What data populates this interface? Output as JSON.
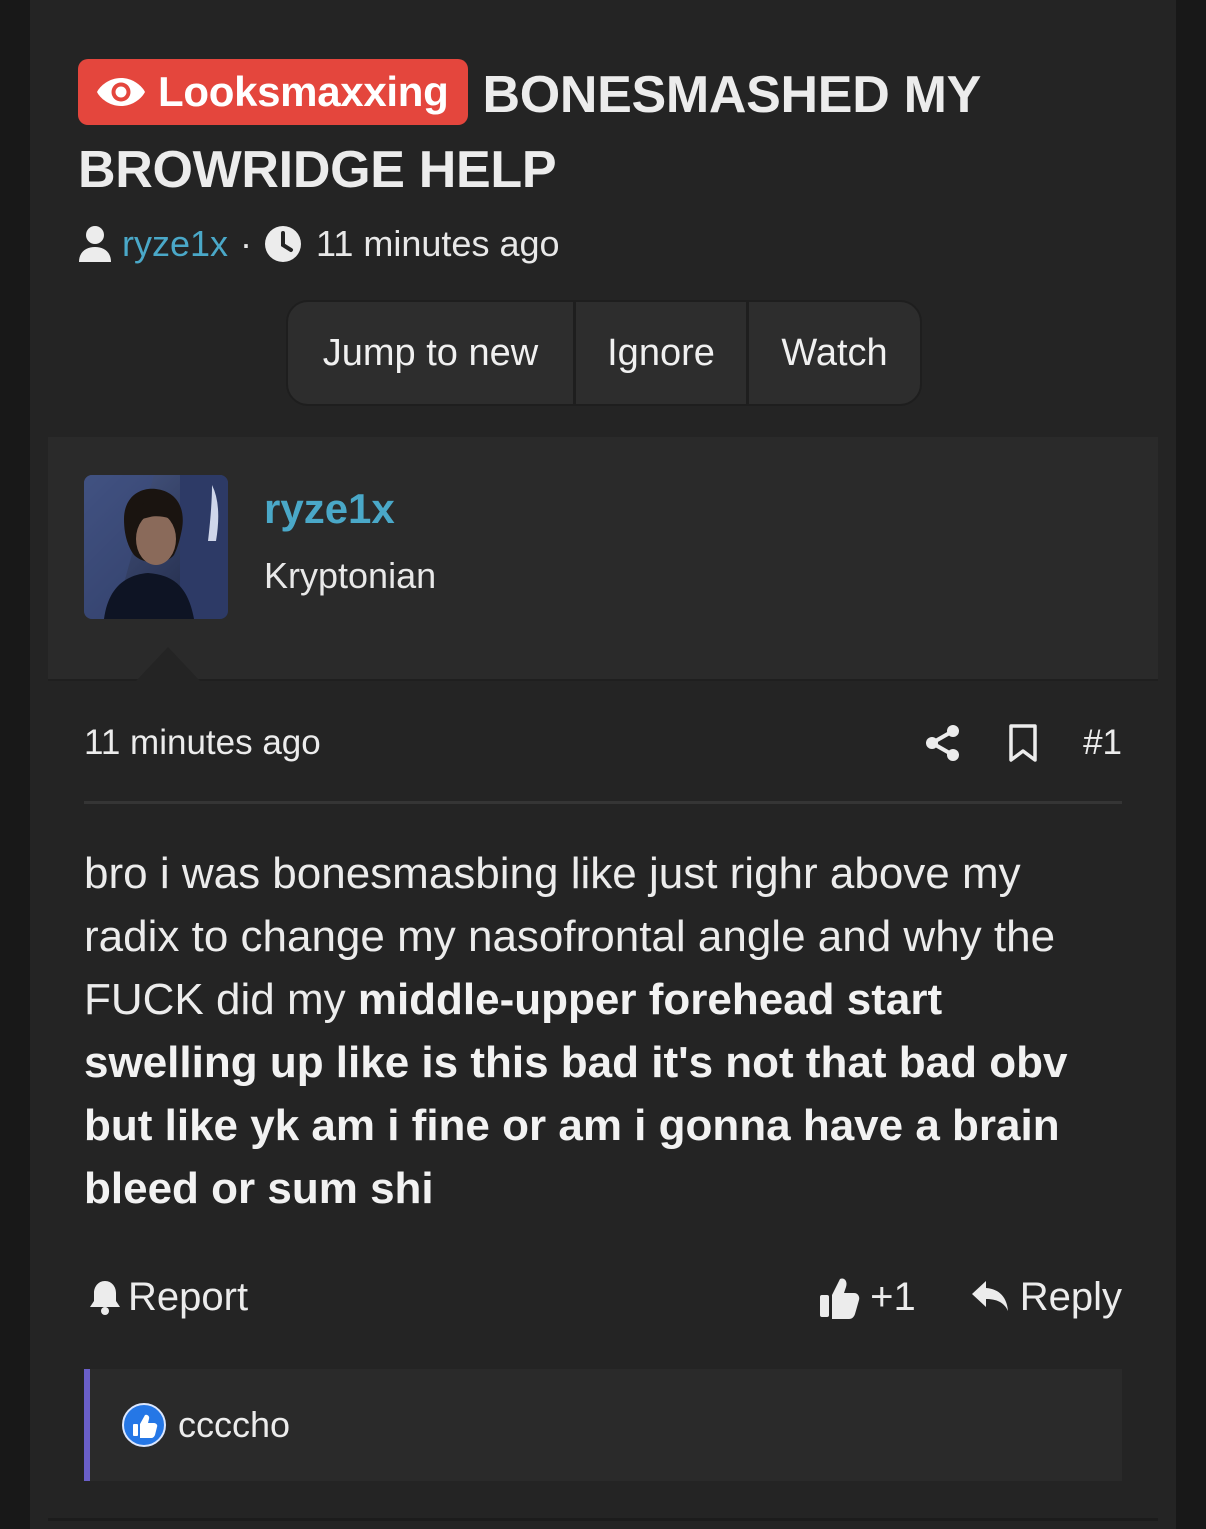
{
  "thread": {
    "prefix": "Looksmaxxing",
    "title": "BONESMASHED MY BROWRIDGE HELP",
    "author": "ryze1x",
    "separator": "·",
    "time": "11 minutes ago"
  },
  "buttons": {
    "jump": "Jump to new",
    "ignore": "Ignore",
    "watch": "Watch"
  },
  "user": {
    "name": "ryze1x",
    "title": "Kryptonian"
  },
  "post": {
    "date": "11 minutes ago",
    "number": "#1",
    "text_plain": "bro i was bonesmasbing like just righr above my radix to change my nasofrontal angle and why the FUCK did my ",
    "text_bold": "middle-upper forehead start swelling up like is this bad it's not that bad obv but like yk am i fine or am i gonna have a brain bleed or sum shi"
  },
  "actions": {
    "report": "Report",
    "like": "+1",
    "reply": "Reply"
  },
  "reactions": {
    "user": "ccccho"
  },
  "colors": {
    "prefix_bg": "#e4463d",
    "link": "#4aa8c8",
    "reaction_border": "#6a5fc8",
    "like_badge": "#2577e6"
  }
}
